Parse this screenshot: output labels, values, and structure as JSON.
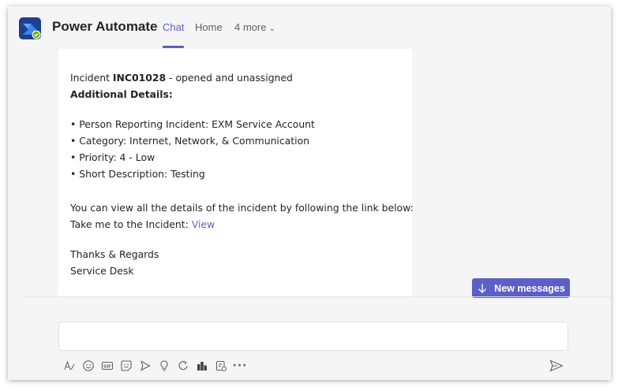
{
  "header": {
    "app_title": "Power Automate",
    "tabs": [
      {
        "label": "Chat",
        "active": true
      },
      {
        "label": "Home",
        "active": false
      },
      {
        "label": "4 more",
        "active": false
      }
    ]
  },
  "message": {
    "incident_prefix": "Incident ",
    "incident_id": "INC01028",
    "incident_status": " - opened and unassigned",
    "details_heading": "Additional Details:",
    "bullets": [
      "• Person Reporting Incident: EXM Service Account",
      "• Category: Internet, Network, & Communication",
      "• Priority: 4 - Low",
      "• Short Description: Testing"
    ],
    "view_text": "You can view all the details of the incident by following the link below:",
    "link_prefix": "Take me to the Incident: ",
    "link_label": "View",
    "closing": "Thanks & Regards",
    "signature": "Service Desk"
  },
  "new_messages_label": "New messages",
  "composer": {
    "placeholder": "",
    "toolbar_icons": [
      "format-icon",
      "emoji-icon",
      "gif-icon",
      "sticker-icon",
      "meet-icon",
      "praise-icon",
      "loop-icon",
      "apps-icon",
      "schedule-icon",
      "more-options-icon"
    ],
    "more_label": "···"
  },
  "colors": {
    "accent": "#5b5fc7",
    "background": "#f5f5f5",
    "card": "#ffffff"
  }
}
